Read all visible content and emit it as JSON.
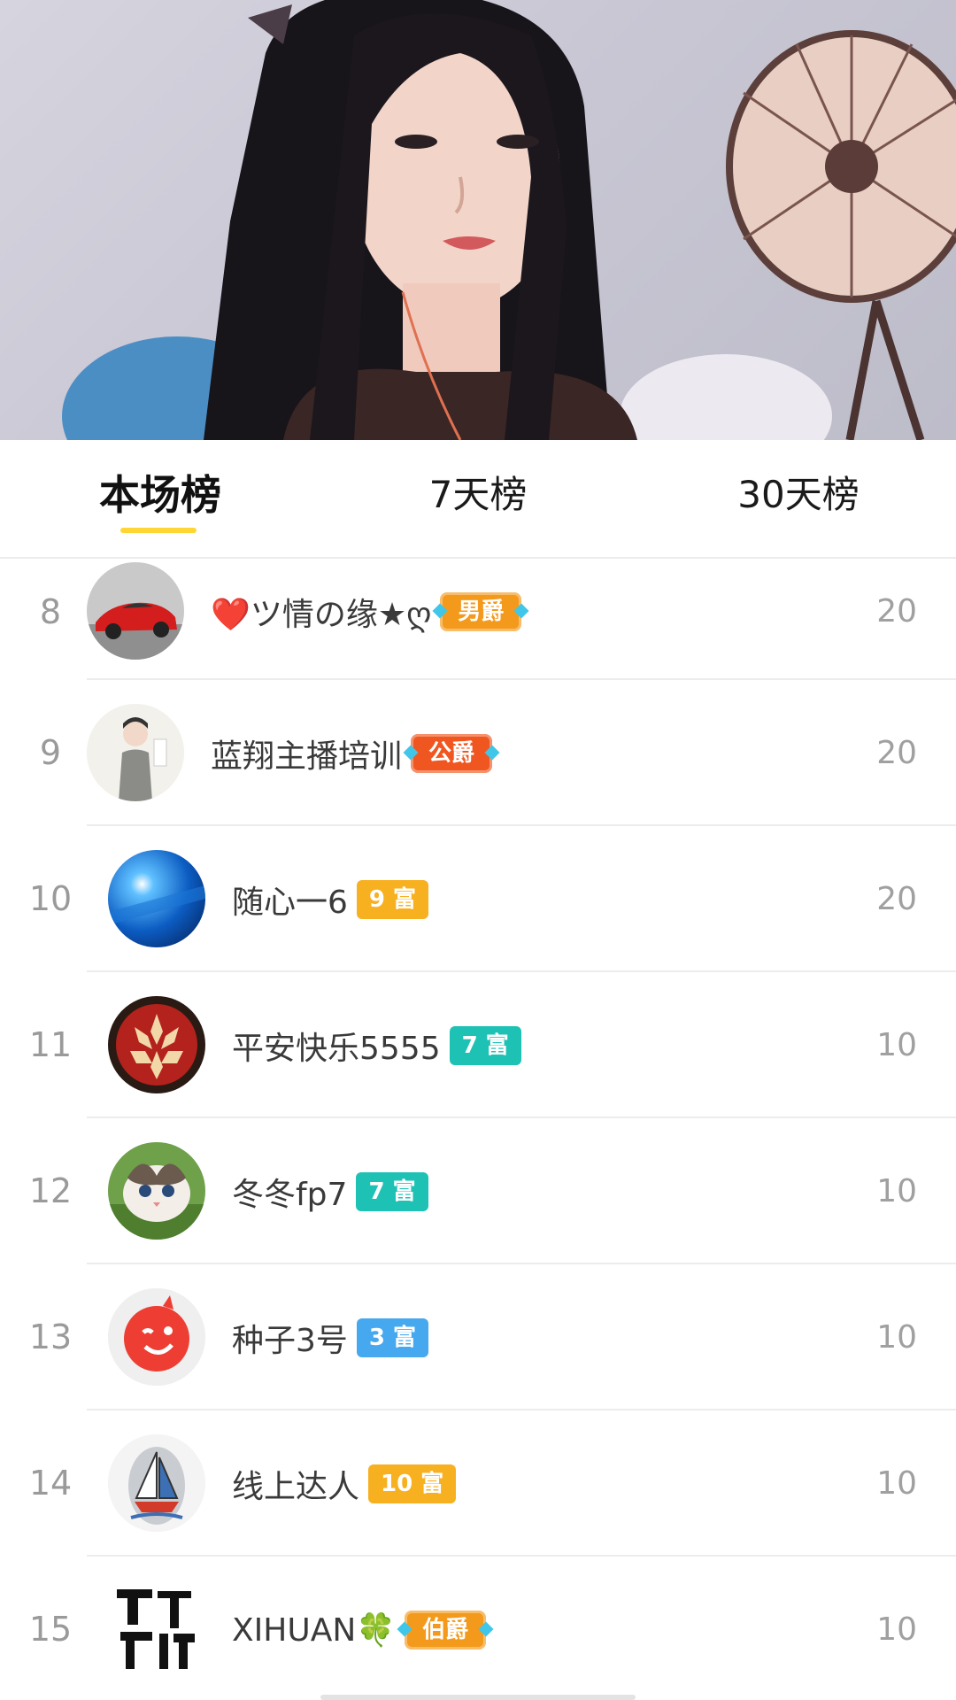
{
  "tabs": [
    {
      "label": "本场榜",
      "active": true
    },
    {
      "label": "7天榜",
      "active": false
    },
    {
      "label": "30天榜",
      "active": false
    }
  ],
  "colors": {
    "accent": "#ffd633",
    "rich_orange": "#f7b020",
    "rich_teal": "#1ec2b5",
    "rich_blue": "#46a8ee",
    "noble_orange": "#f39a1d",
    "noble_red": "#f0561f"
  },
  "rows": [
    {
      "rank": "8",
      "name": "❤️ツ情の缘★ღ",
      "badge": "男爵",
      "badge_kind": "noble",
      "badge_color": "#f39a1d",
      "score": "20",
      "avatar": "red-sports-car-avatar"
    },
    {
      "rank": "9",
      "name": "蓝翔主播培训",
      "badge": "公爵",
      "badge_kind": "noble",
      "badge_color": "#f0561f",
      "score": "20",
      "avatar": "cartoon-figure-avatar"
    },
    {
      "rank": "10",
      "name": "随心一6",
      "badge": "9 富",
      "badge_kind": "rich",
      "badge_color": "#f7b020",
      "score": "20",
      "avatar": "blue-light-avatar"
    },
    {
      "rank": "11",
      "name": "平安快乐5555",
      "badge": "7 富",
      "badge_kind": "rich",
      "badge_color": "#1ec2b5",
      "score": "10",
      "avatar": "carved-fruit-avatar"
    },
    {
      "rank": "12",
      "name": "冬冬fp7",
      "badge": "7 富",
      "badge_kind": "rich",
      "badge_color": "#1ec2b5",
      "score": "10",
      "avatar": "cat-avatar"
    },
    {
      "rank": "13",
      "name": "种子3号",
      "badge": "3 富",
      "badge_kind": "rich",
      "badge_color": "#46a8ee",
      "score": "10",
      "avatar": "red-wink-face-avatar"
    },
    {
      "rank": "14",
      "name": "线上达人",
      "badge": "10 富",
      "badge_kind": "rich",
      "badge_color": "#f7b020",
      "score": "10",
      "avatar": "sailboat-stone-avatar"
    },
    {
      "rank": "15",
      "name": "XIHUAN🍀",
      "badge": "伯爵",
      "badge_kind": "noble",
      "badge_color": "#f39a1d",
      "score": "10",
      "avatar": "calligraphy-avatar"
    }
  ]
}
